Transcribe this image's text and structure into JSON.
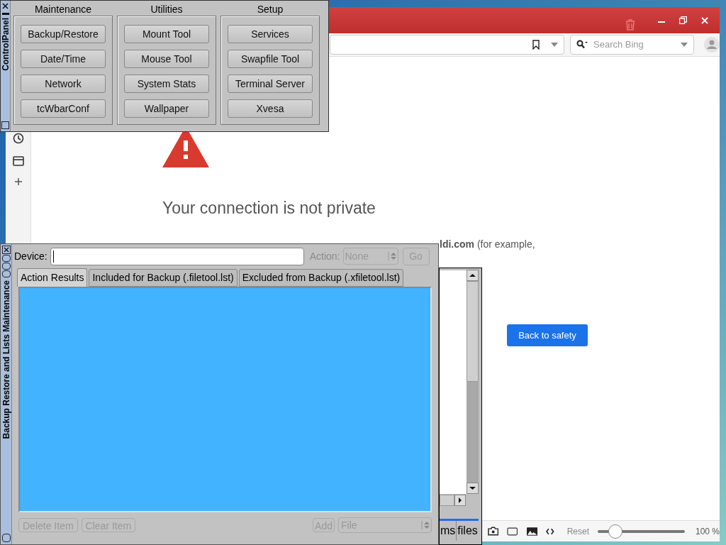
{
  "control_panel": {
    "title": "ControlPanel",
    "groups": [
      {
        "title": "Maintenance",
        "buttons": [
          "Backup/Restore",
          "Date/Time",
          "Network",
          "tcWbarConf"
        ]
      },
      {
        "title": "Utilities",
        "buttons": [
          "Mount Tool",
          "Mouse Tool",
          "System Stats",
          "Wallpaper"
        ]
      },
      {
        "title": "Setup",
        "buttons": [
          "Services",
          "Swapfile Tool",
          "Terminal Server",
          "Xvesa"
        ]
      }
    ]
  },
  "browser": {
    "search_placeholder": "Search Bing",
    "heading": "Your connection is not private",
    "body": "**ldi.com** (for example,",
    "primary_button": "Back to safety",
    "status_bar": {
      "reset": "Reset",
      "zoom": {
        "level": 0.2
      },
      "zoom_reading": "100 %"
    }
  },
  "back_window": {
    "tabs": [
      "ms",
      "files"
    ]
  },
  "backup_window": {
    "title": "Backup Restore and Lists Maintenance",
    "device_label": "Device:",
    "action_label": "Action:",
    "action_value": "None",
    "go_button": "Go",
    "controls_disabled": true,
    "tabs": [
      {
        "label": "Action Results",
        "selected": true
      },
      {
        "label": "Included for Backup (.filetool.lst)",
        "selected": false
      },
      {
        "label": "Excluded from Backup (.xfiletool.lst)",
        "selected": false
      }
    ],
    "bottom_buttons": [
      {
        "label": "Delete Item",
        "disabled": true
      },
      {
        "label": "Clear Item",
        "disabled": true
      }
    ],
    "add_button": {
      "label": "Add",
      "disabled": true
    },
    "add_type": "File"
  }
}
